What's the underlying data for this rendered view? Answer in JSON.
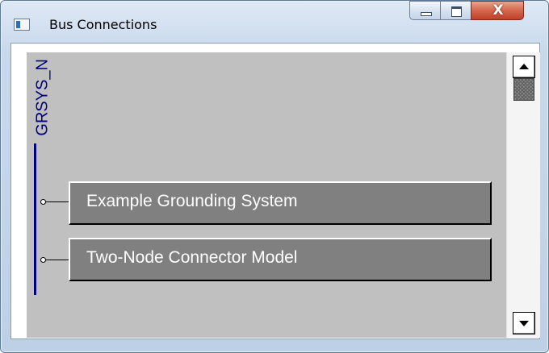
{
  "window": {
    "title": "Bus Connections",
    "icon": "app-window-icon",
    "controls": {
      "minimize_icon": "minimize-icon",
      "maximize_icon": "maximize-icon",
      "close_label": "X"
    }
  },
  "bus": {
    "name": "GRSYS_N",
    "line_color": "#000080"
  },
  "devices": [
    {
      "label": "Example Grounding System"
    },
    {
      "label": "Two-Node Connector Model"
    }
  ],
  "scrollbar": {
    "up_icon": "scroll-up-arrow-icon",
    "down_icon": "scroll-down-arrow-icon"
  },
  "colors": {
    "canvas_bg": "#c0c0c0",
    "device_bg": "#808080",
    "device_text": "#ffffff"
  }
}
